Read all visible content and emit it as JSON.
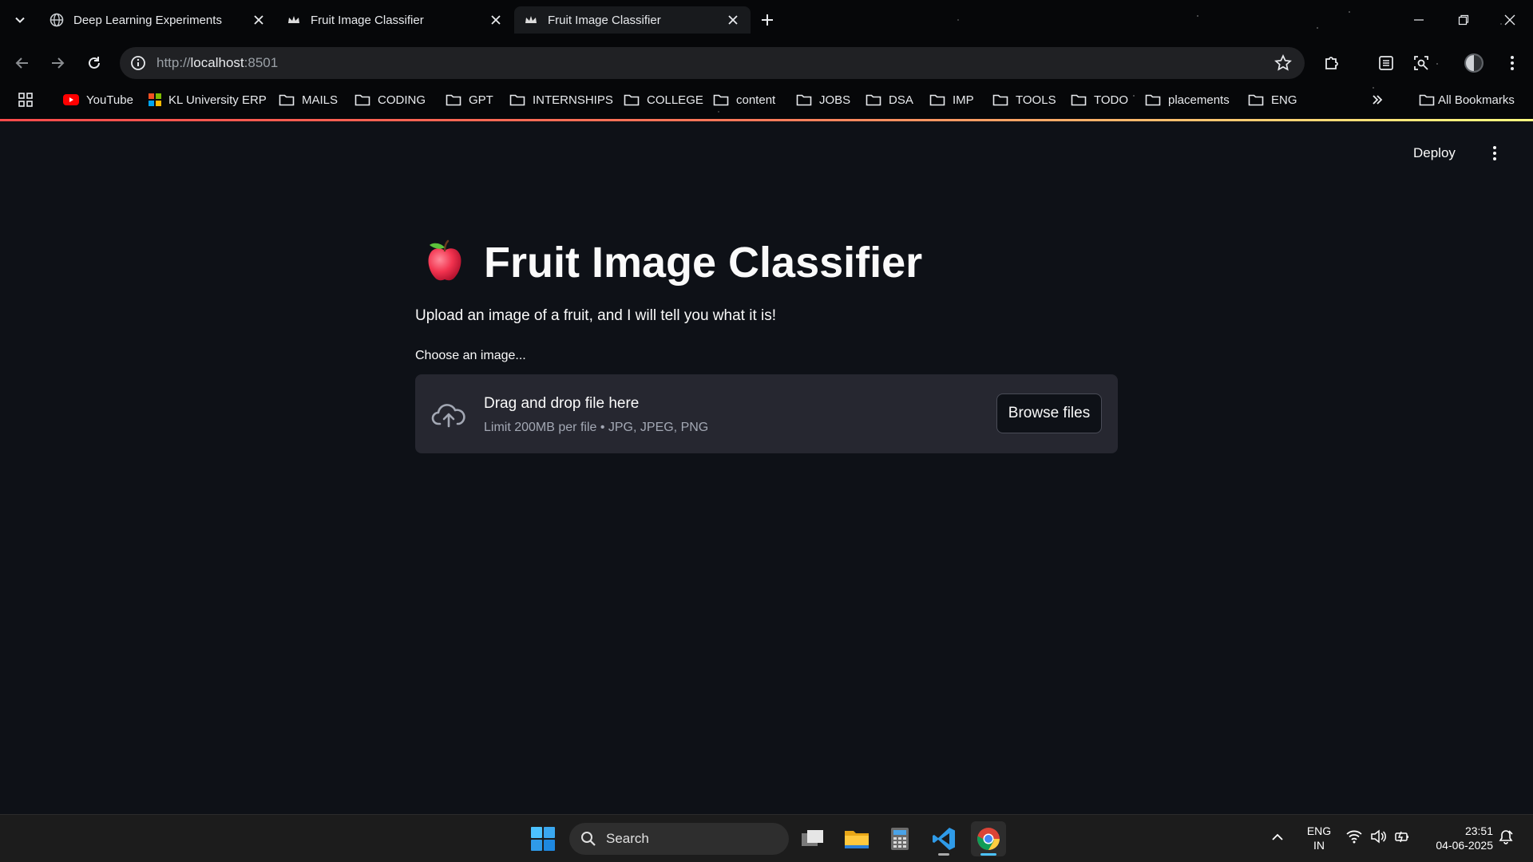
{
  "browser": {
    "tabs": [
      {
        "title": "Deep Learning Experiments",
        "icon": "globe-icon"
      },
      {
        "title": "Fruit Image Classifier",
        "icon": "streamlit-crown-icon"
      },
      {
        "title": "Fruit Image Classifier",
        "icon": "streamlit-crown-icon",
        "active": true
      }
    ],
    "url_scheme": "http://",
    "url_host": "localhost",
    "url_port": ":8501",
    "bookmarks": [
      {
        "label": "YouTube",
        "icon": "youtube-icon"
      },
      {
        "label": "KL University ERP",
        "icon": "colored-grid-icon"
      },
      {
        "label": "MAILS",
        "icon": "folder-icon"
      },
      {
        "label": "CODING",
        "icon": "folder-icon"
      },
      {
        "label": "GPT",
        "icon": "folder-icon"
      },
      {
        "label": "INTERNSHIPS",
        "icon": "folder-icon"
      },
      {
        "label": "COLLEGE",
        "icon": "folder-icon"
      },
      {
        "label": "content",
        "icon": "folder-icon"
      },
      {
        "label": "JOBS",
        "icon": "folder-icon"
      },
      {
        "label": "DSA",
        "icon": "folder-icon"
      },
      {
        "label": "IMP",
        "icon": "folder-icon"
      },
      {
        "label": "TOOLS",
        "icon": "folder-icon"
      },
      {
        "label": "TODO",
        "icon": "folder-icon"
      },
      {
        "label": "placements",
        "icon": "folder-icon"
      },
      {
        "label": "ENG",
        "icon": "folder-icon"
      }
    ],
    "all_bookmarks": "All Bookmarks"
  },
  "app": {
    "deploy_label": "Deploy",
    "title": "Fruit Image Classifier",
    "title_icon": "red-apple-emoji",
    "subtitle": "Upload an image of a fruit, and I will tell you what it is!",
    "uploader": {
      "label": "Choose an image...",
      "drop_title": "Drag and drop file here",
      "drop_hint": "Limit 200MB per file • JPG, JPEG, PNG",
      "browse_label": "Browse files"
    }
  },
  "taskbar": {
    "search_label": "Search",
    "lang_line1": "ENG",
    "lang_line2": "IN",
    "time": "23:51",
    "date": "04-06-2025"
  },
  "colors": {
    "app_bg": "#0e1117",
    "dropzone_bg": "#262730",
    "accent_gradient_start": "#ff4b4b",
    "accent_gradient_end": "#fffd80",
    "taskbar_bg": "#1c1c1c"
  }
}
